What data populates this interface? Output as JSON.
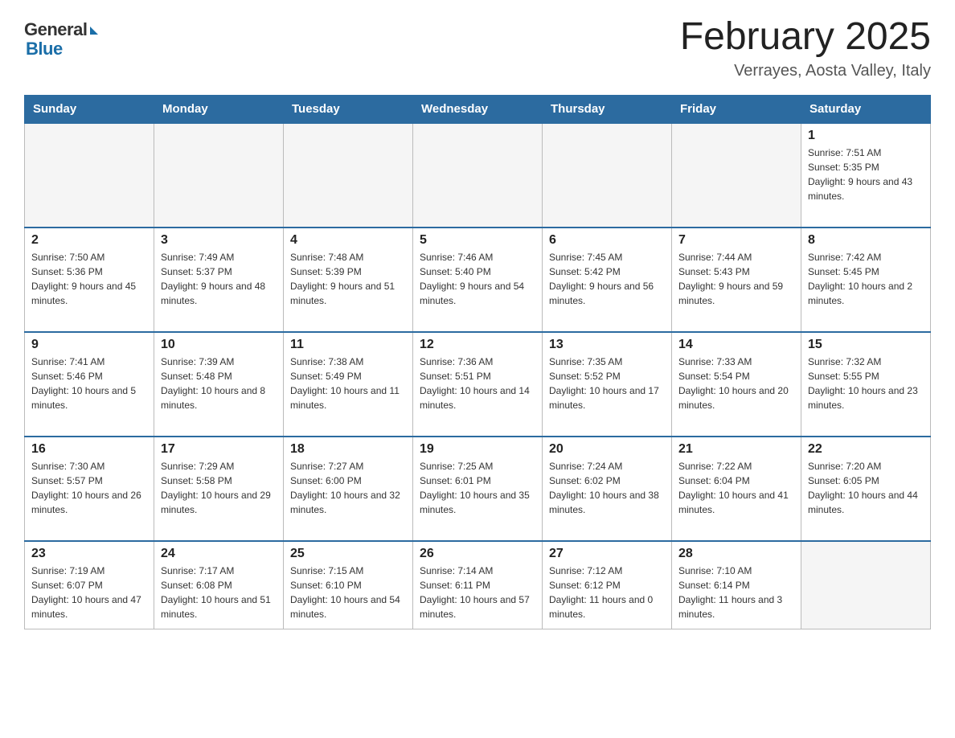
{
  "logo": {
    "general": "General",
    "blue": "Blue"
  },
  "title": "February 2025",
  "location": "Verrayes, Aosta Valley, Italy",
  "days_of_week": [
    "Sunday",
    "Monday",
    "Tuesday",
    "Wednesday",
    "Thursday",
    "Friday",
    "Saturday"
  ],
  "weeks": [
    [
      {
        "day": "",
        "info": ""
      },
      {
        "day": "",
        "info": ""
      },
      {
        "day": "",
        "info": ""
      },
      {
        "day": "",
        "info": ""
      },
      {
        "day": "",
        "info": ""
      },
      {
        "day": "",
        "info": ""
      },
      {
        "day": "1",
        "info": "Sunrise: 7:51 AM\nSunset: 5:35 PM\nDaylight: 9 hours and 43 minutes."
      }
    ],
    [
      {
        "day": "2",
        "info": "Sunrise: 7:50 AM\nSunset: 5:36 PM\nDaylight: 9 hours and 45 minutes."
      },
      {
        "day": "3",
        "info": "Sunrise: 7:49 AM\nSunset: 5:37 PM\nDaylight: 9 hours and 48 minutes."
      },
      {
        "day": "4",
        "info": "Sunrise: 7:48 AM\nSunset: 5:39 PM\nDaylight: 9 hours and 51 minutes."
      },
      {
        "day": "5",
        "info": "Sunrise: 7:46 AM\nSunset: 5:40 PM\nDaylight: 9 hours and 54 minutes."
      },
      {
        "day": "6",
        "info": "Sunrise: 7:45 AM\nSunset: 5:42 PM\nDaylight: 9 hours and 56 minutes."
      },
      {
        "day": "7",
        "info": "Sunrise: 7:44 AM\nSunset: 5:43 PM\nDaylight: 9 hours and 59 minutes."
      },
      {
        "day": "8",
        "info": "Sunrise: 7:42 AM\nSunset: 5:45 PM\nDaylight: 10 hours and 2 minutes."
      }
    ],
    [
      {
        "day": "9",
        "info": "Sunrise: 7:41 AM\nSunset: 5:46 PM\nDaylight: 10 hours and 5 minutes."
      },
      {
        "day": "10",
        "info": "Sunrise: 7:39 AM\nSunset: 5:48 PM\nDaylight: 10 hours and 8 minutes."
      },
      {
        "day": "11",
        "info": "Sunrise: 7:38 AM\nSunset: 5:49 PM\nDaylight: 10 hours and 11 minutes."
      },
      {
        "day": "12",
        "info": "Sunrise: 7:36 AM\nSunset: 5:51 PM\nDaylight: 10 hours and 14 minutes."
      },
      {
        "day": "13",
        "info": "Sunrise: 7:35 AM\nSunset: 5:52 PM\nDaylight: 10 hours and 17 minutes."
      },
      {
        "day": "14",
        "info": "Sunrise: 7:33 AM\nSunset: 5:54 PM\nDaylight: 10 hours and 20 minutes."
      },
      {
        "day": "15",
        "info": "Sunrise: 7:32 AM\nSunset: 5:55 PM\nDaylight: 10 hours and 23 minutes."
      }
    ],
    [
      {
        "day": "16",
        "info": "Sunrise: 7:30 AM\nSunset: 5:57 PM\nDaylight: 10 hours and 26 minutes."
      },
      {
        "day": "17",
        "info": "Sunrise: 7:29 AM\nSunset: 5:58 PM\nDaylight: 10 hours and 29 minutes."
      },
      {
        "day": "18",
        "info": "Sunrise: 7:27 AM\nSunset: 6:00 PM\nDaylight: 10 hours and 32 minutes."
      },
      {
        "day": "19",
        "info": "Sunrise: 7:25 AM\nSunset: 6:01 PM\nDaylight: 10 hours and 35 minutes."
      },
      {
        "day": "20",
        "info": "Sunrise: 7:24 AM\nSunset: 6:02 PM\nDaylight: 10 hours and 38 minutes."
      },
      {
        "day": "21",
        "info": "Sunrise: 7:22 AM\nSunset: 6:04 PM\nDaylight: 10 hours and 41 minutes."
      },
      {
        "day": "22",
        "info": "Sunrise: 7:20 AM\nSunset: 6:05 PM\nDaylight: 10 hours and 44 minutes."
      }
    ],
    [
      {
        "day": "23",
        "info": "Sunrise: 7:19 AM\nSunset: 6:07 PM\nDaylight: 10 hours and 47 minutes."
      },
      {
        "day": "24",
        "info": "Sunrise: 7:17 AM\nSunset: 6:08 PM\nDaylight: 10 hours and 51 minutes."
      },
      {
        "day": "25",
        "info": "Sunrise: 7:15 AM\nSunset: 6:10 PM\nDaylight: 10 hours and 54 minutes."
      },
      {
        "day": "26",
        "info": "Sunrise: 7:14 AM\nSunset: 6:11 PM\nDaylight: 10 hours and 57 minutes."
      },
      {
        "day": "27",
        "info": "Sunrise: 7:12 AM\nSunset: 6:12 PM\nDaylight: 11 hours and 0 minutes."
      },
      {
        "day": "28",
        "info": "Sunrise: 7:10 AM\nSunset: 6:14 PM\nDaylight: 11 hours and 3 minutes."
      },
      {
        "day": "",
        "info": ""
      }
    ]
  ]
}
